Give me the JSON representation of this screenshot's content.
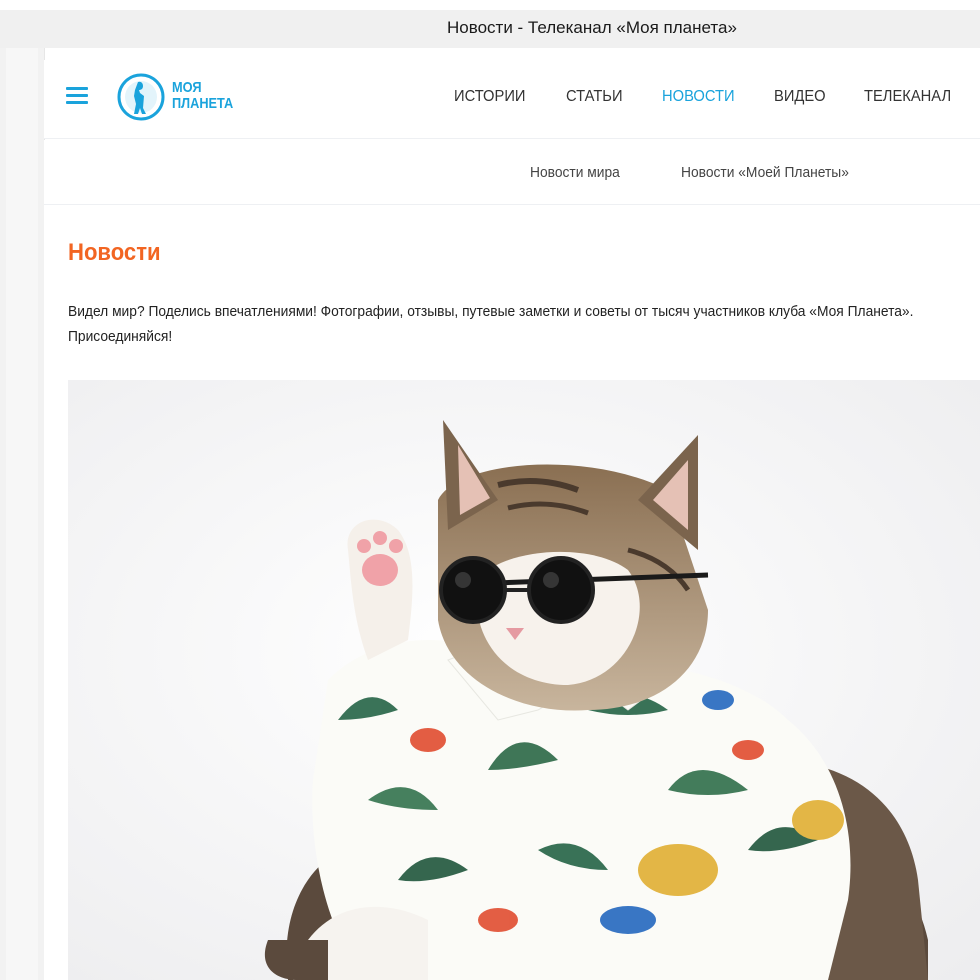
{
  "window": {
    "title": "Новости - Телеканал «Моя планета»"
  },
  "header": {
    "logo": {
      "line1": "МОЯ",
      "line2": "ПЛАНЕТА"
    },
    "nav": [
      {
        "label": "ИСТОРИИ",
        "active": false
      },
      {
        "label": "СТАТЬИ",
        "active": false
      },
      {
        "label": "НОВОСТИ",
        "active": true
      },
      {
        "label": "ВИДЕО",
        "active": false
      },
      {
        "label": "ТЕЛЕКАНАЛ",
        "active": false
      }
    ]
  },
  "subnav": {
    "items": [
      "Новости мира",
      "Новости «Моей Планеты»"
    ]
  },
  "main": {
    "title": "Новости",
    "intro": "Видел мир? Поделись впечатлениями! Фотографии, отзывы, путевые заметки и советы от тысяч участников клуба «Моя Планета». Присоединяйся!",
    "hero_image": {
      "icon": "cat-in-sunglasses-photo"
    }
  },
  "colors": {
    "accent": "#1aa3dc",
    "title": "#f26522",
    "text": "#222222"
  }
}
